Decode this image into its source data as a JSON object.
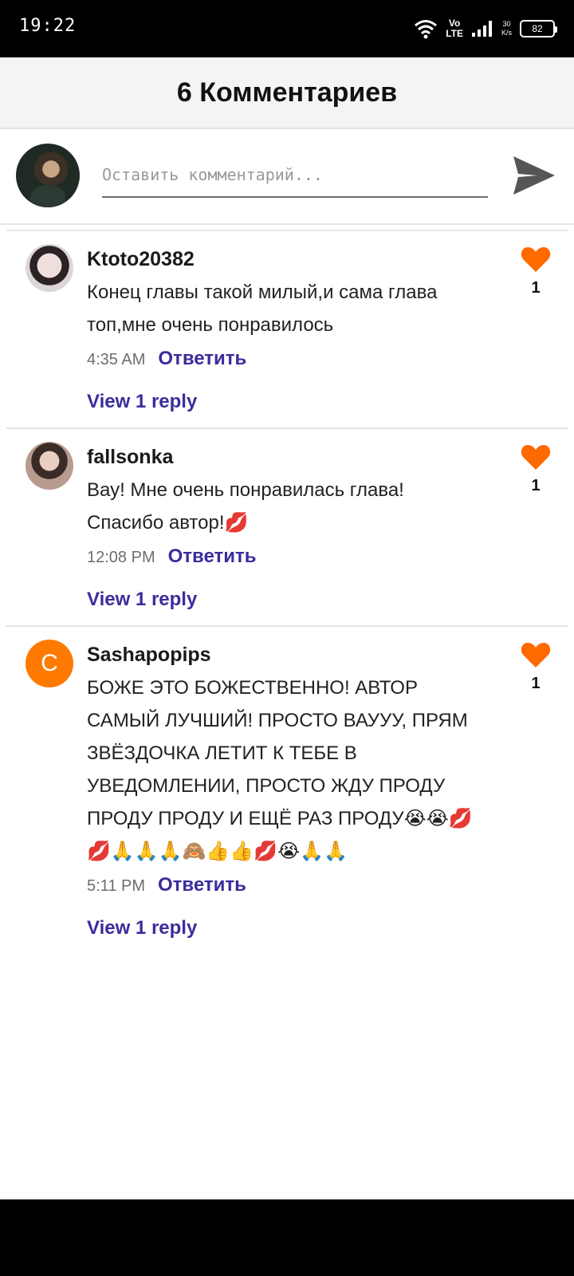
{
  "status_bar": {
    "time": "19:22",
    "volte_top": "Vo",
    "volte_bottom": "LTE",
    "speed_value": "30",
    "speed_unit": "K/s",
    "battery": "82"
  },
  "header": {
    "title": "6 Комментариев"
  },
  "compose": {
    "placeholder": "Оставить комментарий...",
    "send_icon": "send-icon"
  },
  "comments": [
    {
      "username": "Ktoto20382",
      "text": "Конец главы такой милый,и сама глава топ,мне очень понравилось",
      "time": "4:35 AM",
      "reply_label": "Ответить",
      "view_replies": "View 1 reply",
      "likes": "1"
    },
    {
      "username": "fallsonka",
      "text": "Вау! Мне очень понравилась глава! Спасибо автор!💋",
      "time": "12:08 PM",
      "reply_label": "Ответить",
      "view_replies": "View 1 reply",
      "likes": "1"
    },
    {
      "username": "Sashapopips",
      "avatar_letter": "C",
      "text": "БОЖЕ ЭТО БОЖЕСТВЕННО! АВТОР САМЫЙ ЛУЧШИЙ! ПРОСТО ВАУУУ, ПРЯМ ЗВЁЗДОЧКА ЛЕТИТ К ТЕБЕ В УВЕДОМЛЕНИИ, ПРОСТО ЖДУ ПРОДУ ПРОДУ ПРОДУ И ЕЩЁ РАЗ ПРОДУ😭😭💋💋🙏🙏🙏🙈👍👍💋😭🙏🙏",
      "time": "5:11 PM",
      "reply_label": "Ответить",
      "view_replies": "View 1 reply",
      "likes": "1"
    }
  ],
  "colors": {
    "accent_orange": "#ff6a00",
    "link_purple": "#3a2d9c",
    "avatar_orange": "#ff7a00"
  }
}
